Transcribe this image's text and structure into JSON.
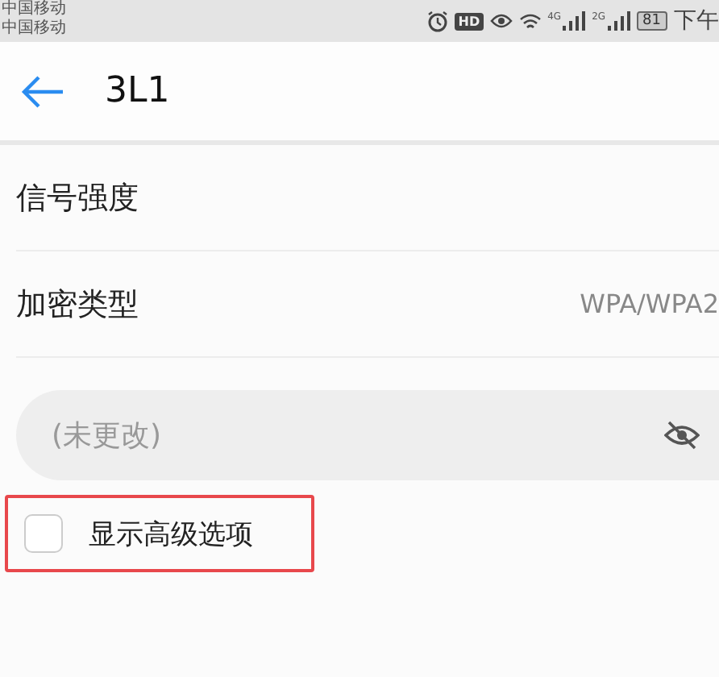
{
  "status_bar": {
    "carriers": [
      "中国移动",
      "中国移动"
    ],
    "hd": "HD",
    "signals": [
      {
        "label": "4G"
      },
      {
        "label": "2G"
      }
    ],
    "battery": "81",
    "time": "下午"
  },
  "header": {
    "title": "3L1"
  },
  "rows": [
    {
      "label": "信号强度"
    },
    {
      "label": "加密类型",
      "value": "WPA/WPA2"
    }
  ],
  "password": {
    "placeholder": "(未更改)"
  },
  "advanced": {
    "label": "显示高级选项",
    "checked": false,
    "highlighted": true
  }
}
